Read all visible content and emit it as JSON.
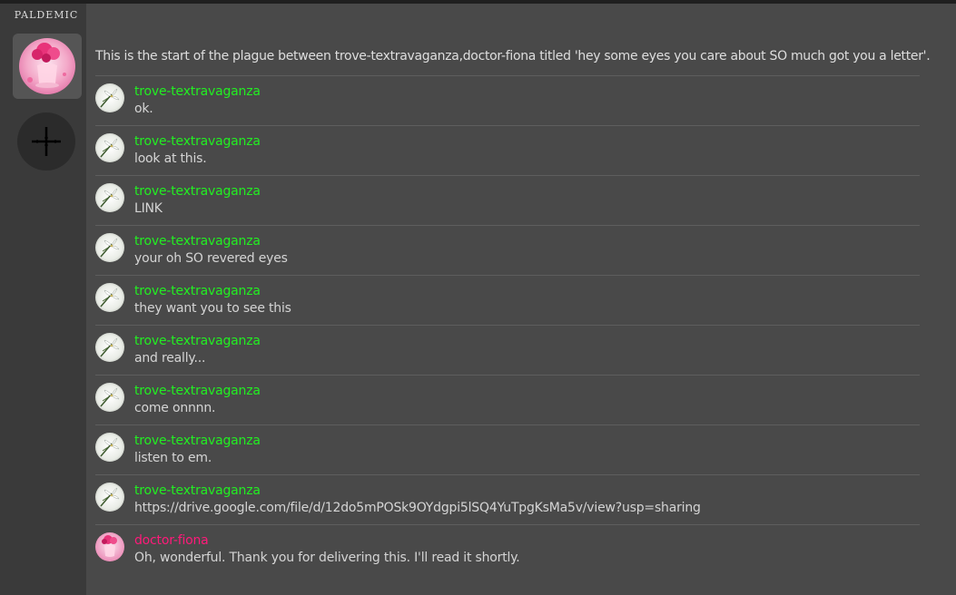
{
  "app": {
    "title": "PALDEMIC",
    "add_server_icon": "plus-icon"
  },
  "colors": {
    "background": "#494949",
    "sidebar": "#3a3a3a",
    "author_green": "#22ee22",
    "author_pink": "#ff1a7a",
    "text": "#d4d4d4"
  },
  "channel": {
    "intro": "This is the start of the plague between trove-textravaganza,doctor-fiona titled 'hey some eyes you care about SO much got you a letter'."
  },
  "messages": [
    {
      "author": "trove-textravaganza",
      "text": "ok.",
      "avatar": "flower-avatar"
    },
    {
      "author": "trove-textravaganza",
      "text": "look at this.",
      "avatar": "flower-avatar"
    },
    {
      "author": "trove-textravaganza",
      "text": "LINK",
      "avatar": "flower-avatar"
    },
    {
      "author": "trove-textravaganza",
      "text": "your oh SO revered eyes",
      "avatar": "flower-avatar"
    },
    {
      "author": "trove-textravaganza",
      "text": "they want you to see this",
      "avatar": "flower-avatar"
    },
    {
      "author": "trove-textravaganza",
      "text": "and really...",
      "avatar": "flower-avatar"
    },
    {
      "author": "trove-textravaganza",
      "text": "come onnnn.",
      "avatar": "flower-avatar"
    },
    {
      "author": "trove-textravaganza",
      "text": "listen to em.",
      "avatar": "flower-avatar"
    },
    {
      "author": "trove-textravaganza",
      "text": "https://drive.google.com/file/d/12do5mPOSk9OYdgpi5lSQ4YuTpgKsMa5v/view?usp=sharing",
      "avatar": "flower-avatar"
    },
    {
      "author": "doctor-fiona",
      "text": "Oh, wonderful. Thank you for delivering this. I'll read it shortly.",
      "avatar": "pink-vase-avatar"
    }
  ]
}
